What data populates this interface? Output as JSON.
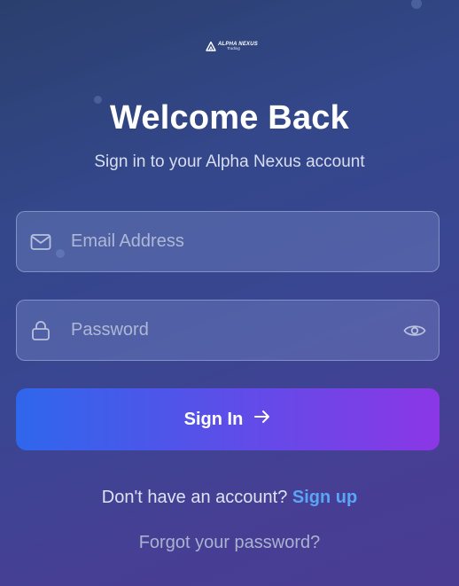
{
  "brand": {
    "name": "ALPHA NEXUS",
    "sub": "Trading"
  },
  "header": {
    "title": "Welcome Back",
    "subtitle": "Sign in to your Alpha Nexus account"
  },
  "form": {
    "email": {
      "placeholder": "Email Address",
      "value": "",
      "icon": "mail-icon"
    },
    "password": {
      "placeholder": "Password",
      "value": "",
      "icon": "lock-icon",
      "toggle_icon": "eye-icon"
    },
    "submit_label": "Sign In",
    "submit_icon": "arrow-right-icon"
  },
  "footer": {
    "signup_prompt": "Don't have an account?",
    "signup_link": "Sign up",
    "forgot_link": "Forgot your password?"
  },
  "colors": {
    "accent_start": "#2f67ec",
    "accent_end": "#8b37e6",
    "link": "#58a6f5"
  }
}
